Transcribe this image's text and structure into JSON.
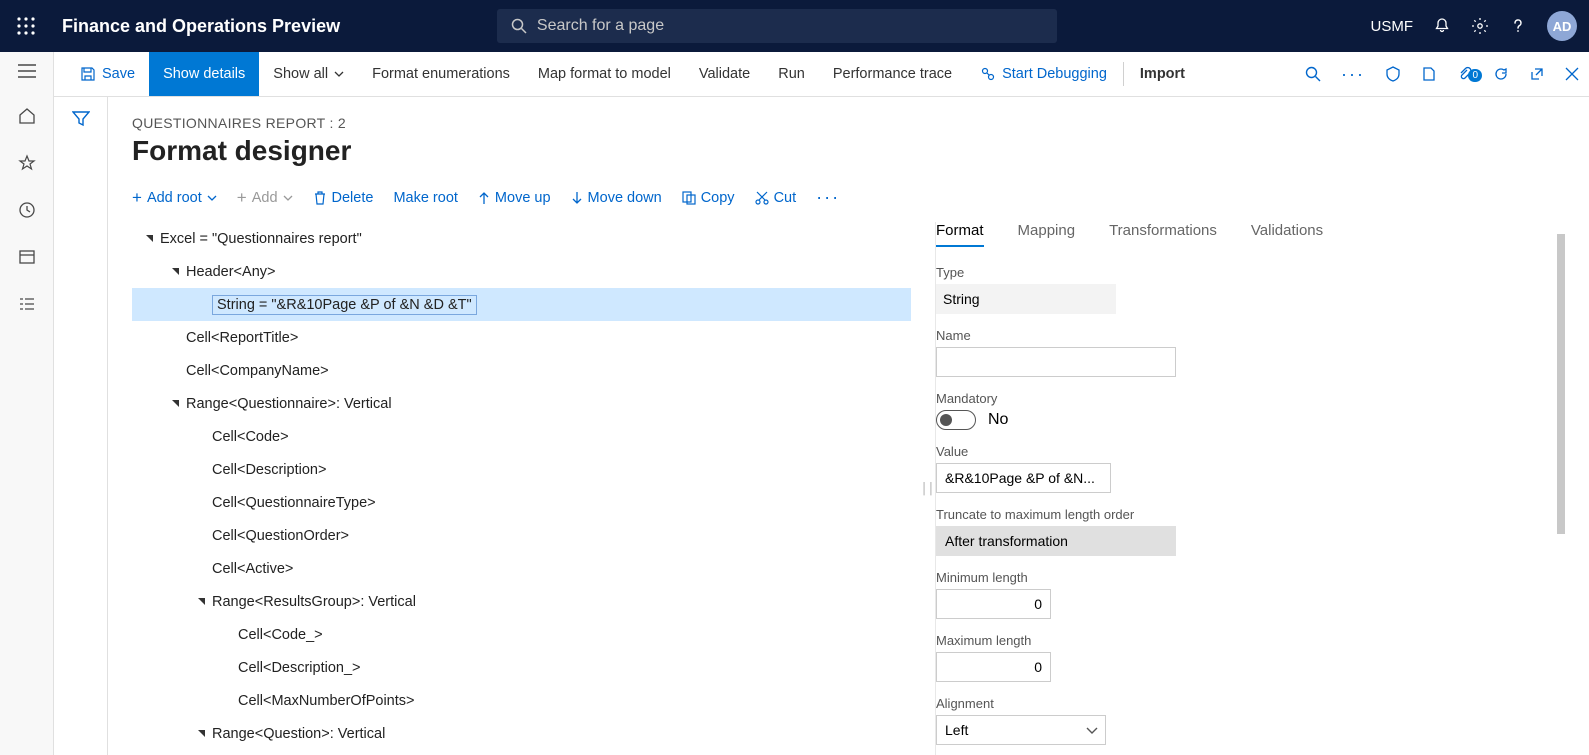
{
  "topnav": {
    "app_title": "Finance and Operations Preview",
    "search_placeholder": "Search for a page",
    "entity": "USMF",
    "avatar": "AD"
  },
  "cmdbar": {
    "save": "Save",
    "show_details": "Show details",
    "show_all": "Show all",
    "format_enum": "Format enumerations",
    "map_format": "Map format to model",
    "validate": "Validate",
    "run": "Run",
    "perf_trace": "Performance trace",
    "start_debug": "Start Debugging",
    "import": "Import",
    "attach_badge": "0"
  },
  "page": {
    "breadcrumb": "QUESTIONNAIRES REPORT : 2",
    "title": "Format designer"
  },
  "toolbar2": {
    "add_root": "Add root",
    "add": "Add",
    "delete": "Delete",
    "make_root": "Make root",
    "move_up": "Move up",
    "move_down": "Move down",
    "copy": "Copy",
    "cut": "Cut"
  },
  "tree": [
    {
      "indent": 0,
      "caret": true,
      "label": "Excel = \"Questionnaires report\""
    },
    {
      "indent": 1,
      "caret": true,
      "label": "Header<Any>"
    },
    {
      "indent": 2,
      "caret": false,
      "label": "String = \"&R&10Page &P of &N &D &T\"",
      "selected": true
    },
    {
      "indent": 1,
      "caret": false,
      "label": "Cell<ReportTitle>"
    },
    {
      "indent": 1,
      "caret": false,
      "label": "Cell<CompanyName>"
    },
    {
      "indent": 1,
      "caret": true,
      "label": "Range<Questionnaire>: Vertical"
    },
    {
      "indent": 2,
      "caret": false,
      "label": "Cell<Code>"
    },
    {
      "indent": 2,
      "caret": false,
      "label": "Cell<Description>"
    },
    {
      "indent": 2,
      "caret": false,
      "label": "Cell<QuestionnaireType>"
    },
    {
      "indent": 2,
      "caret": false,
      "label": "Cell<QuestionOrder>"
    },
    {
      "indent": 2,
      "caret": false,
      "label": "Cell<Active>"
    },
    {
      "indent": 2,
      "caret": true,
      "label": "Range<ResultsGroup>: Vertical"
    },
    {
      "indent": 3,
      "caret": false,
      "label": "Cell<Code_>"
    },
    {
      "indent": 3,
      "caret": false,
      "label": "Cell<Description_>"
    },
    {
      "indent": 3,
      "caret": false,
      "label": "Cell<MaxNumberOfPoints>"
    },
    {
      "indent": 2,
      "caret": true,
      "label": "Range<Question>: Vertical"
    }
  ],
  "tabs": {
    "format": "Format",
    "mapping": "Mapping",
    "transformations": "Transformations",
    "validations": "Validations"
  },
  "props": {
    "type_label": "Type",
    "type_value": "String",
    "name_label": "Name",
    "name_value": "",
    "mandatory_label": "Mandatory",
    "mandatory_value": "No",
    "value_label": "Value",
    "value_value": "&R&10Page &P of &N...",
    "truncate_label": "Truncate to maximum length order",
    "truncate_value": "After transformation",
    "minlen_label": "Minimum length",
    "minlen_value": "0",
    "maxlen_label": "Maximum length",
    "maxlen_value": "0",
    "align_label": "Alignment",
    "align_value": "Left"
  }
}
